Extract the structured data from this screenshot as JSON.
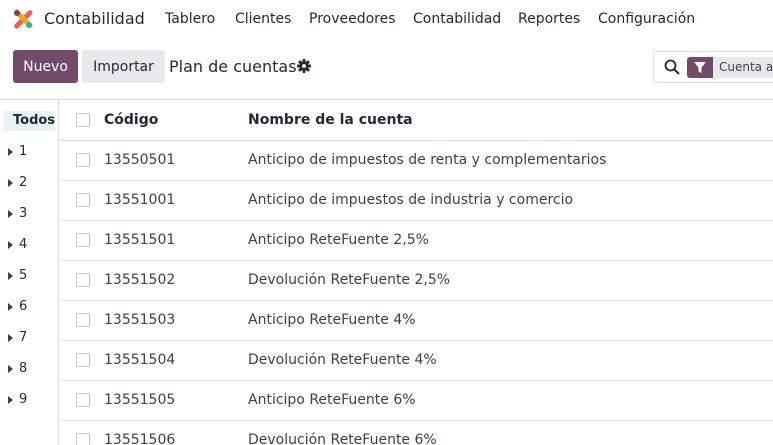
{
  "navbar": {
    "app_name": "Contabilidad",
    "menu": [
      "Tablero",
      "Clientes",
      "Proveedores",
      "Contabilidad",
      "Reportes",
      "Configuración"
    ]
  },
  "control_panel": {
    "new_label": "Nuevo",
    "import_label": "Importar",
    "breadcrumb": "Plan de cuentas",
    "search_facet": "Cuenta a"
  },
  "sidepanel": {
    "all_label": "Todos",
    "groups": [
      "1",
      "2",
      "3",
      "4",
      "5",
      "6",
      "7",
      "8",
      "9"
    ]
  },
  "list": {
    "columns": {
      "code": "Código",
      "name": "Nombre de la cuenta"
    },
    "rows": [
      {
        "code": "13550501",
        "name": "Anticipo de impuestos de renta y complementarios"
      },
      {
        "code": "13551001",
        "name": "Anticipo de impuestos de industria y comercio"
      },
      {
        "code": "13551501",
        "name": "Anticipo ReteFuente 2,5%"
      },
      {
        "code": "13551502",
        "name": "Devolución ReteFuente 2,5%"
      },
      {
        "code": "13551503",
        "name": "Anticipo ReteFuente 4%"
      },
      {
        "code": "13551504",
        "name": "Devolución ReteFuente 4%"
      },
      {
        "code": "13551505",
        "name": "Anticipo ReteFuente 6%"
      },
      {
        "code": "13551506",
        "name": "Devolución ReteFuente 6%"
      }
    ]
  },
  "colors": {
    "brand": "#714b67",
    "selected_bg": "#e6f2f3",
    "border": "#d8dadd"
  }
}
